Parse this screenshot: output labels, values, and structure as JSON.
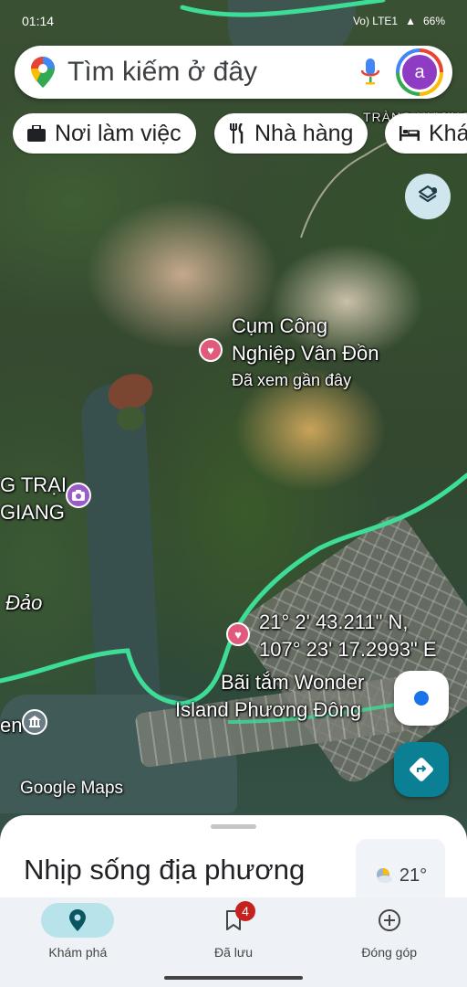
{
  "status_bar": {
    "time": "01:14",
    "network": "Vo) LTE1",
    "battery": "66%"
  },
  "search": {
    "placeholder": "Tìm kiếm ở đây",
    "avatar_letter": "a",
    "icons": {
      "logo": "maps-pin-icon",
      "mic": "mic-icon"
    }
  },
  "chips": [
    {
      "label": "Nơi làm việc",
      "icon": "briefcase-icon"
    },
    {
      "label": "Nhà hàng",
      "icon": "fork-knife-icon"
    },
    {
      "label": "Khá",
      "icon": "bed-icon"
    }
  ],
  "map": {
    "labels": {
      "top_partial": "TRÀNG HƯƠNG",
      "industrial_zone_line1": "Cụm Công",
      "industrial_zone_line2": "Nghiệp Vân Đồn",
      "industrial_zone_sub": "Đã xem gần đây",
      "camp_line1": "G TRẠI",
      "camp_line2": "GIANG",
      "island": "Đảo",
      "coords_line1": "21° 2' 43.211\" N,",
      "coords_line2": "107° 23' 17.2993\" E",
      "beach_line1": "Bãi tắm Wonder",
      "beach_line2": "Island Phương Đông",
      "left_partial": "en"
    },
    "attribution": "Google Maps",
    "colors": {
      "route": "#3ddc97",
      "saved_pin": "#e15a7c",
      "poi_pin": "#9a5cc6",
      "directions_button": "#0b7f93"
    }
  },
  "bottom_sheet": {
    "title": "Nhịp sống địa phương",
    "weather_temp": "21°"
  },
  "nav": {
    "items": [
      {
        "label": "Khám phá",
        "icon": "location-pin-icon",
        "active": true
      },
      {
        "label": "Đã lưu",
        "icon": "bookmark-icon",
        "badge": "4"
      },
      {
        "label": "Đóng góp",
        "icon": "plus-circle-icon"
      }
    ]
  }
}
